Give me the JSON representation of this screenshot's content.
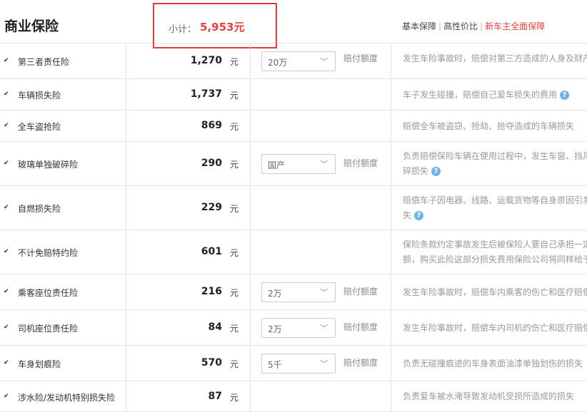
{
  "header": {
    "title": "商业保险",
    "subtotal_label": "小计：",
    "subtotal_value": "5,953元",
    "tabs": [
      {
        "label": "基本保障"
      },
      {
        "label": "高性价比"
      },
      {
        "label": "新车主全面保障"
      }
    ]
  },
  "rows": [
    {
      "checked": true,
      "name": "第三者责任险",
      "price": "1,270",
      "unit": "元",
      "select": "20万",
      "hint": "赔付额度",
      "desc1": "发生车险事故时，赔偿对第三方造成的人身及财产",
      "desc2": ""
    },
    {
      "checked": true,
      "name": "车辆损失险",
      "price": "1,737",
      "unit": "元",
      "select": "",
      "hint": "",
      "desc1": "车子发生碰撞，赔偿自己爱车损失的费用",
      "desc2": ""
    },
    {
      "checked": true,
      "name": "全车盗抢险",
      "price": "869",
      "unit": "元",
      "select": "",
      "hint": "",
      "desc1": "赔偿全车被盗窃、抢劫、抢夺造成的车辆损失",
      "desc2": ""
    },
    {
      "checked": true,
      "name": "玻璃单独破碎险",
      "price": "290",
      "unit": "元",
      "select": "国产",
      "hint": "赔付额度",
      "desc1": "负责赔偿保险车辆在使用过程中，发生车窗、挡风",
      "desc2": "碎损失"
    },
    {
      "checked": true,
      "name": "自燃损失险",
      "price": "229",
      "unit": "元",
      "select": "",
      "hint": "",
      "desc1": "赔偿车子因电器、线路、运载货物等自身原因引发",
      "desc2": "失"
    },
    {
      "checked": true,
      "name": "不计免赔特约险",
      "price": "601",
      "unit": "元",
      "select": "",
      "hint": "",
      "desc1": "保险条款约定事故发生后被保险人要自己承担一定",
      "desc2": "额，购买此险这部分损失费用保险公司将同样给予"
    },
    {
      "checked": true,
      "name": "乘客座位责任险",
      "price": "216",
      "unit": "元",
      "select": "2万",
      "hint": "赔付额度",
      "desc1": "发生车险事故时，赔偿车内乘客的伤亡和医疗赔偿",
      "desc2": ""
    },
    {
      "checked": true,
      "name": "司机座位责任险",
      "price": "84",
      "unit": "元",
      "select": "2万",
      "hint": "赔付额度",
      "desc1": "发生车险事故时，赔偿车内司机的伤亡和医疗赔偿",
      "desc2": ""
    },
    {
      "checked": true,
      "name": "车身划痕险",
      "price": "570",
      "unit": "元",
      "select": "5千",
      "hint": "赔付额度",
      "desc1": "负责无碰撞痕迹的车身表面油漆单独划伤的损失",
      "desc2": ""
    },
    {
      "checked": true,
      "name": "涉水险/发动机特别损失险",
      "price": "87",
      "unit": "元",
      "select": "",
      "hint": "",
      "desc1": "负责爱车被水淹导致发动机受损所造成的损失",
      "desc2": ""
    }
  ]
}
